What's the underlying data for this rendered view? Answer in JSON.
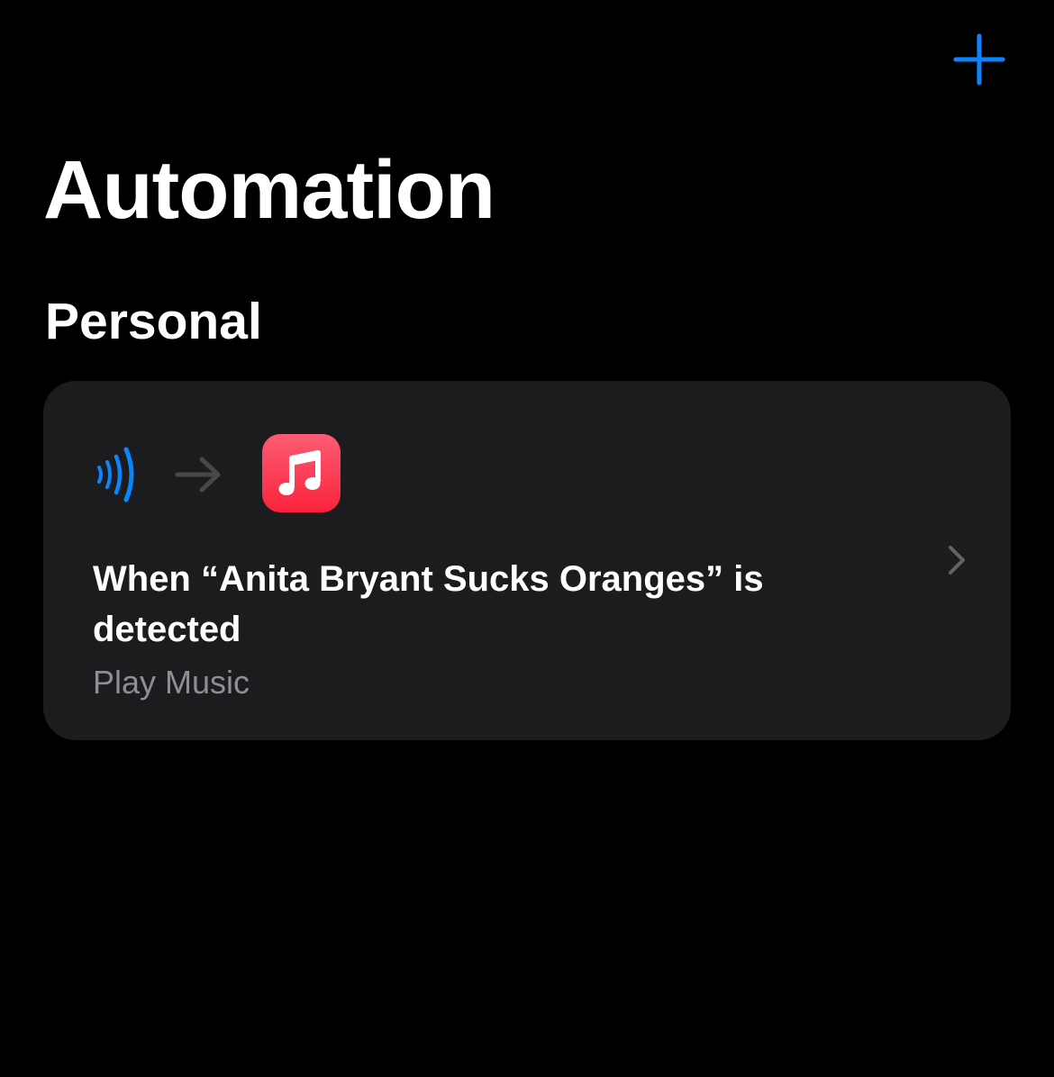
{
  "header": {
    "add_icon": "plus-icon",
    "accent_color": "#0a84ff"
  },
  "page": {
    "title": "Automation"
  },
  "section": {
    "title": "Personal"
  },
  "automation": {
    "trigger_icon": "nfc-waves-icon",
    "flow_icon": "arrow-right-icon",
    "action_app_icon": "apple-music-icon",
    "action_app_color": "#fa233b",
    "title": "When “Anita Bryant Sucks Oranges” is detected",
    "subtitle": "Play Music",
    "disclosure_icon": "chevron-right-icon"
  }
}
